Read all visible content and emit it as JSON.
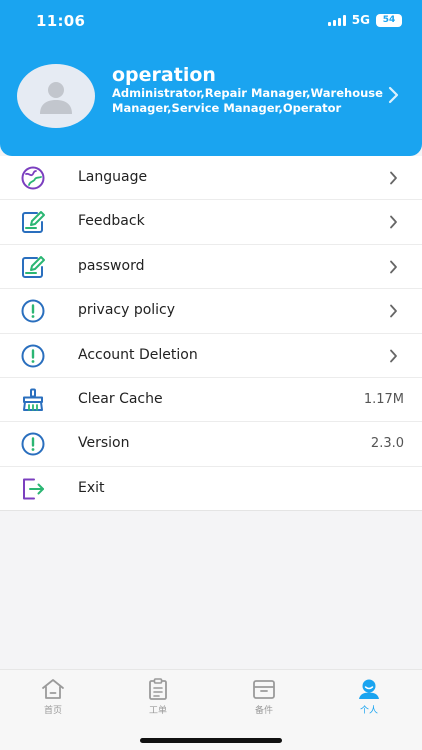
{
  "status_bar": {
    "time": "11:06",
    "network": "5G",
    "battery": "54"
  },
  "profile": {
    "name": "operation",
    "roles": "Administrator,Repair Manager,Warehouse Manager,Service Manager,Operator"
  },
  "menu": {
    "language": {
      "label": "Language",
      "icon": "globe-icon"
    },
    "feedback": {
      "label": "Feedback",
      "icon": "edit-icon"
    },
    "password": {
      "label": "password",
      "icon": "edit-icon"
    },
    "privacy": {
      "label": "privacy policy",
      "icon": "alert-circle-icon"
    },
    "account_deletion": {
      "label": "Account Deletion",
      "icon": "alert-circle-icon"
    },
    "clear_cache": {
      "label": "Clear Cache",
      "value": "1.17M",
      "icon": "broom-icon"
    },
    "version": {
      "label": "Version",
      "value": "2.3.0",
      "icon": "alert-circle-icon"
    },
    "exit": {
      "label": "Exit",
      "icon": "logout-icon"
    }
  },
  "tabbar": {
    "tabs": [
      {
        "label": "首页",
        "icon": "home-icon",
        "active": false
      },
      {
        "label": "工单",
        "icon": "clipboard-icon",
        "active": false
      },
      {
        "label": "备件",
        "icon": "box-icon",
        "active": false
      },
      {
        "label": "个人",
        "icon": "person-icon",
        "active": true
      }
    ]
  },
  "colors": {
    "accent": "#1aa4f0",
    "icon_blue": "#2a6fbe",
    "icon_green": "#2bb673",
    "icon_purple": "#7b3fbf"
  }
}
